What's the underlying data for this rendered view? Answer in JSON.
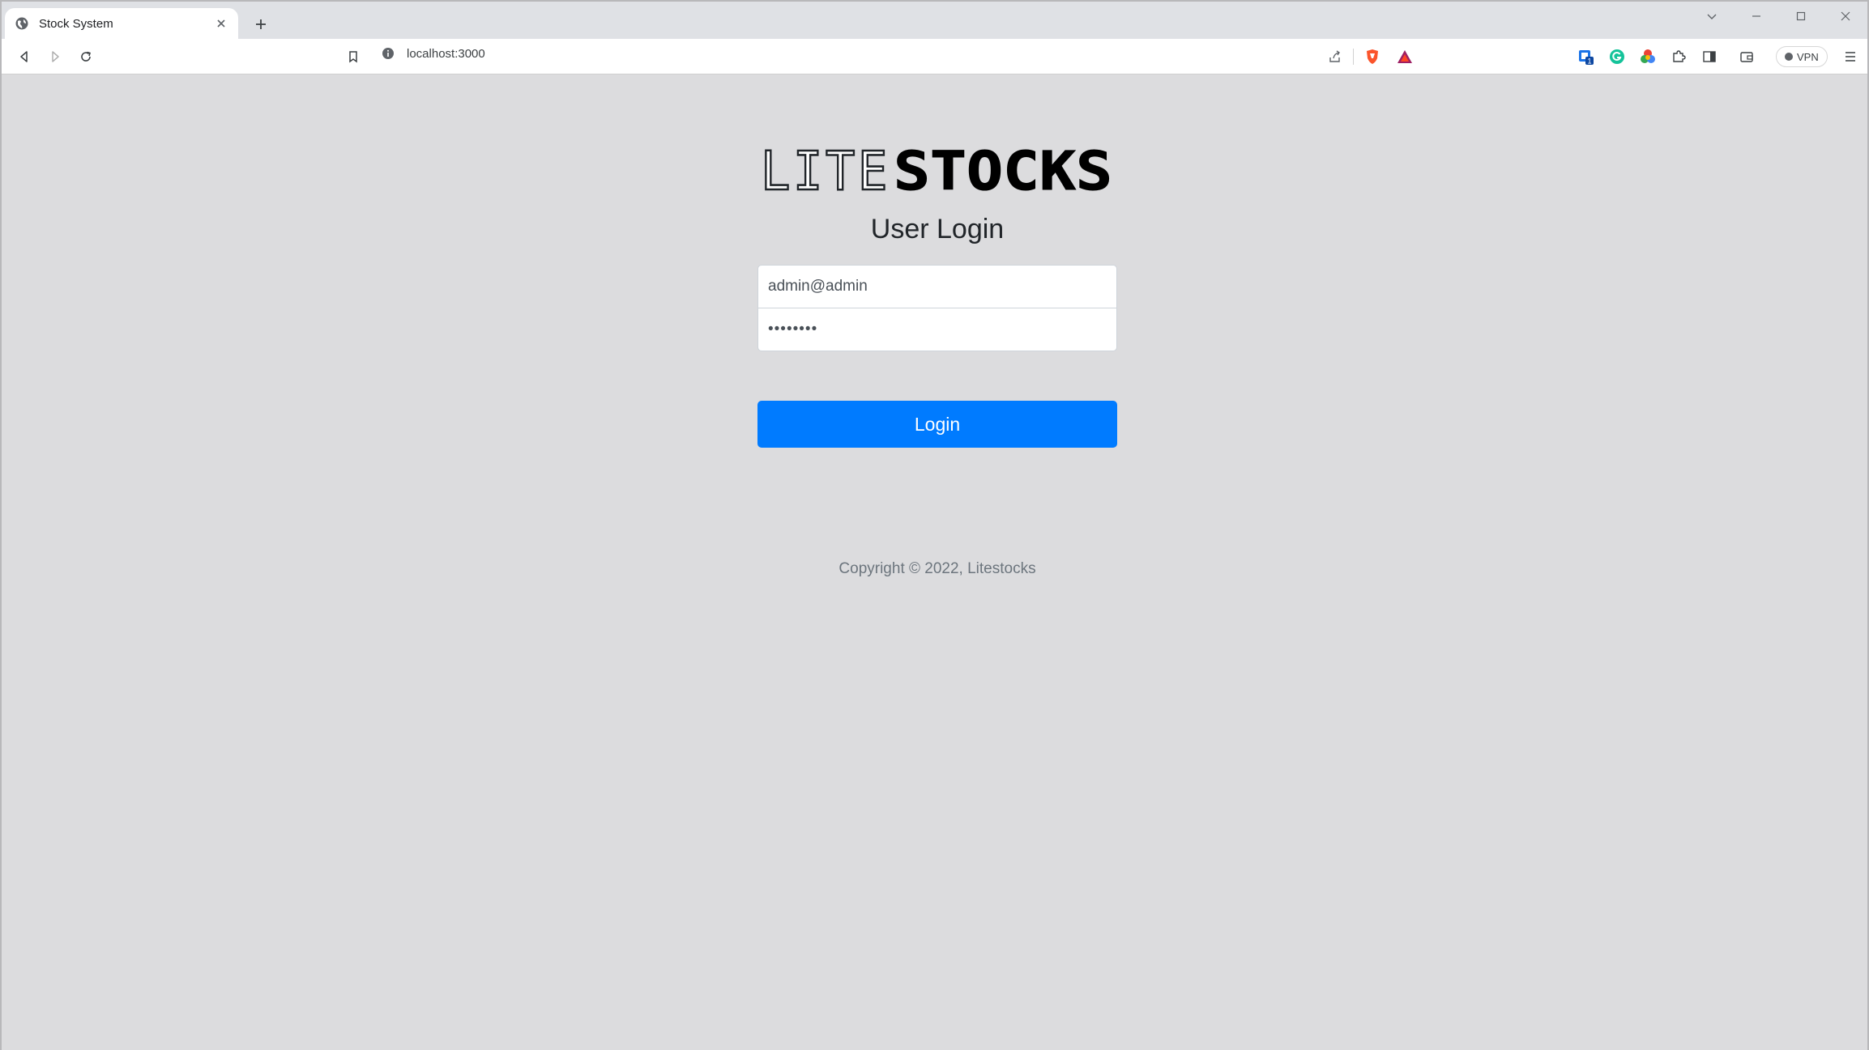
{
  "browser": {
    "tab": {
      "title": "Stock System"
    },
    "address_bar": {
      "url": "localhost:3000"
    },
    "vpn_label": "VPN"
  },
  "login": {
    "logo": {
      "lite": "LITE",
      "stocks": "STOCKS"
    },
    "heading": "User Login",
    "email": {
      "value": "admin@admin"
    },
    "password": {
      "value": "••••••••"
    },
    "submit_label": "Login",
    "footer": "Copyright © 2022, Litestocks"
  },
  "colors": {
    "primary": "#007bff",
    "page_background": "#dcdcde",
    "muted_text": "#6c757d"
  },
  "icons": {
    "tab_favicon": "globe-icon",
    "tab_close": "close-icon",
    "new_tab": "plus-icon",
    "back": "back-icon",
    "forward": "forward-icon",
    "reload": "reload-icon",
    "bookmark": "bookmark-icon",
    "site_info": "info-icon",
    "share": "share-icon",
    "brave_shield": "brave-shield-icon",
    "rewards": "brave-rewards-icon",
    "extensions": "puzzle-icon",
    "sidebar": "sidebar-icon",
    "wallet": "wallet-icon",
    "menu": "hamburger-menu-icon"
  }
}
